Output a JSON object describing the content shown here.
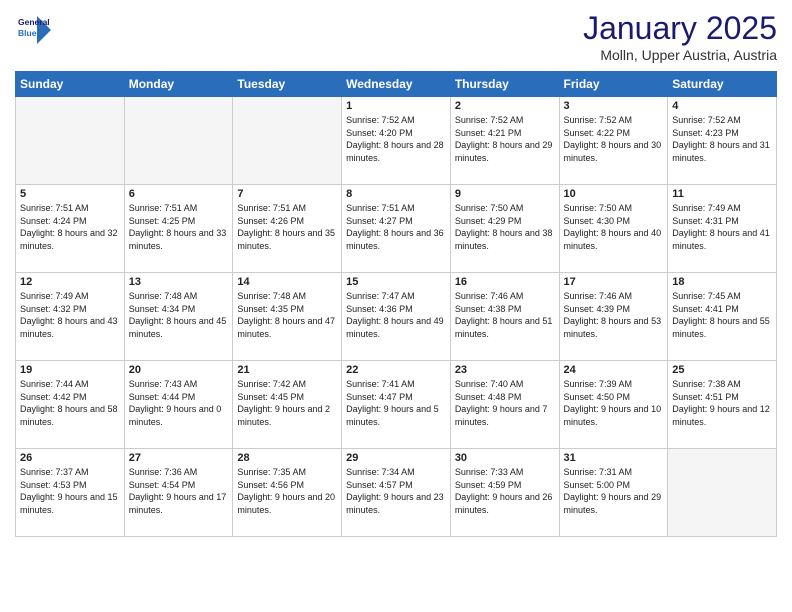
{
  "logo": {
    "line1": "General",
    "line2": "Blue"
  },
  "header": {
    "month": "January 2025",
    "location": "Molln, Upper Austria, Austria"
  },
  "weekdays": [
    "Sunday",
    "Monday",
    "Tuesday",
    "Wednesday",
    "Thursday",
    "Friday",
    "Saturday"
  ],
  "weeks": [
    [
      {
        "day": "",
        "empty": true
      },
      {
        "day": "",
        "empty": true
      },
      {
        "day": "",
        "empty": true
      },
      {
        "day": "1",
        "sunrise": "7:52 AM",
        "sunset": "4:20 PM",
        "daylight": "8 hours and 28 minutes."
      },
      {
        "day": "2",
        "sunrise": "7:52 AM",
        "sunset": "4:21 PM",
        "daylight": "8 hours and 29 minutes."
      },
      {
        "day": "3",
        "sunrise": "7:52 AM",
        "sunset": "4:22 PM",
        "daylight": "8 hours and 30 minutes."
      },
      {
        "day": "4",
        "sunrise": "7:52 AM",
        "sunset": "4:23 PM",
        "daylight": "8 hours and 31 minutes."
      }
    ],
    [
      {
        "day": "5",
        "sunrise": "7:51 AM",
        "sunset": "4:24 PM",
        "daylight": "8 hours and 32 minutes."
      },
      {
        "day": "6",
        "sunrise": "7:51 AM",
        "sunset": "4:25 PM",
        "daylight": "8 hours and 33 minutes."
      },
      {
        "day": "7",
        "sunrise": "7:51 AM",
        "sunset": "4:26 PM",
        "daylight": "8 hours and 35 minutes."
      },
      {
        "day": "8",
        "sunrise": "7:51 AM",
        "sunset": "4:27 PM",
        "daylight": "8 hours and 36 minutes."
      },
      {
        "day": "9",
        "sunrise": "7:50 AM",
        "sunset": "4:29 PM",
        "daylight": "8 hours and 38 minutes."
      },
      {
        "day": "10",
        "sunrise": "7:50 AM",
        "sunset": "4:30 PM",
        "daylight": "8 hours and 40 minutes."
      },
      {
        "day": "11",
        "sunrise": "7:49 AM",
        "sunset": "4:31 PM",
        "daylight": "8 hours and 41 minutes."
      }
    ],
    [
      {
        "day": "12",
        "sunrise": "7:49 AM",
        "sunset": "4:32 PM",
        "daylight": "8 hours and 43 minutes."
      },
      {
        "day": "13",
        "sunrise": "7:48 AM",
        "sunset": "4:34 PM",
        "daylight": "8 hours and 45 minutes."
      },
      {
        "day": "14",
        "sunrise": "7:48 AM",
        "sunset": "4:35 PM",
        "daylight": "8 hours and 47 minutes."
      },
      {
        "day": "15",
        "sunrise": "7:47 AM",
        "sunset": "4:36 PM",
        "daylight": "8 hours and 49 minutes."
      },
      {
        "day": "16",
        "sunrise": "7:46 AM",
        "sunset": "4:38 PM",
        "daylight": "8 hours and 51 minutes."
      },
      {
        "day": "17",
        "sunrise": "7:46 AM",
        "sunset": "4:39 PM",
        "daylight": "8 hours and 53 minutes."
      },
      {
        "day": "18",
        "sunrise": "7:45 AM",
        "sunset": "4:41 PM",
        "daylight": "8 hours and 55 minutes."
      }
    ],
    [
      {
        "day": "19",
        "sunrise": "7:44 AM",
        "sunset": "4:42 PM",
        "daylight": "8 hours and 58 minutes."
      },
      {
        "day": "20",
        "sunrise": "7:43 AM",
        "sunset": "4:44 PM",
        "daylight": "9 hours and 0 minutes."
      },
      {
        "day": "21",
        "sunrise": "7:42 AM",
        "sunset": "4:45 PM",
        "daylight": "9 hours and 2 minutes."
      },
      {
        "day": "22",
        "sunrise": "7:41 AM",
        "sunset": "4:47 PM",
        "daylight": "9 hours and 5 minutes."
      },
      {
        "day": "23",
        "sunrise": "7:40 AM",
        "sunset": "4:48 PM",
        "daylight": "9 hours and 7 minutes."
      },
      {
        "day": "24",
        "sunrise": "7:39 AM",
        "sunset": "4:50 PM",
        "daylight": "9 hours and 10 minutes."
      },
      {
        "day": "25",
        "sunrise": "7:38 AM",
        "sunset": "4:51 PM",
        "daylight": "9 hours and 12 minutes."
      }
    ],
    [
      {
        "day": "26",
        "sunrise": "7:37 AM",
        "sunset": "4:53 PM",
        "daylight": "9 hours and 15 minutes."
      },
      {
        "day": "27",
        "sunrise": "7:36 AM",
        "sunset": "4:54 PM",
        "daylight": "9 hours and 17 minutes."
      },
      {
        "day": "28",
        "sunrise": "7:35 AM",
        "sunset": "4:56 PM",
        "daylight": "9 hours and 20 minutes."
      },
      {
        "day": "29",
        "sunrise": "7:34 AM",
        "sunset": "4:57 PM",
        "daylight": "9 hours and 23 minutes."
      },
      {
        "day": "30",
        "sunrise": "7:33 AM",
        "sunset": "4:59 PM",
        "daylight": "9 hours and 26 minutes."
      },
      {
        "day": "31",
        "sunrise": "7:31 AM",
        "sunset": "5:00 PM",
        "daylight": "9 hours and 29 minutes."
      },
      {
        "day": "",
        "empty": true
      }
    ]
  ],
  "labels": {
    "sunrise": "Sunrise:",
    "sunset": "Sunset:",
    "daylight": "Daylight:"
  }
}
